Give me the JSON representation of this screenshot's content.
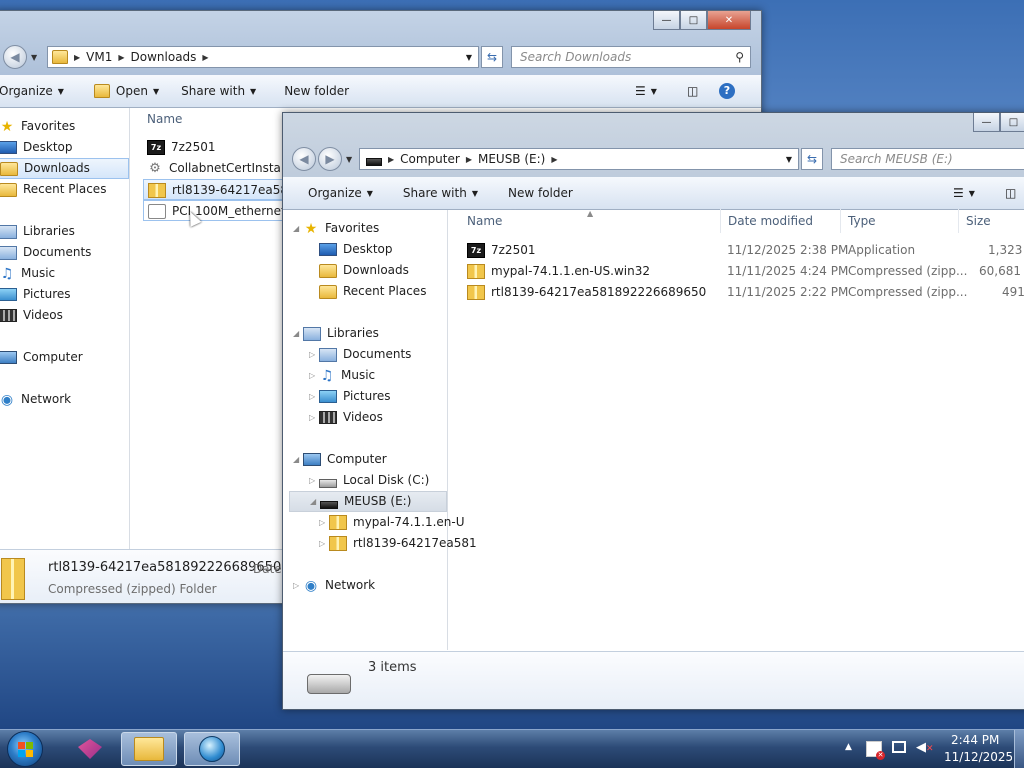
{
  "back_window": {
    "breadcrumb": [
      "VM1",
      "Downloads"
    ],
    "search_placeholder": "Search Downloads",
    "toolbar": {
      "organize": "Organize",
      "open": "Open",
      "share_with": "Share with",
      "new_folder": "New folder"
    },
    "nav": {
      "favorites": "Favorites",
      "desktop": "Desktop",
      "downloads": "Downloads",
      "recent_places": "Recent Places",
      "libraries": "Libraries",
      "documents": "Documents",
      "music": "Music",
      "pictures": "Pictures",
      "videos": "Videos",
      "computer": "Computer",
      "network": "Network"
    },
    "column_name": "Name",
    "files": [
      "7z2501",
      "CollabnetCertInstaller",
      "rtl8139-64217ea581892",
      "PCI 100M_ethernet_d"
    ],
    "details": {
      "name": "rtl8139-64217ea581892226689650",
      "type": "Compressed (zipped) Folder",
      "date_label": "Date"
    }
  },
  "front_window": {
    "breadcrumb": [
      "Computer",
      "MEUSB (E:)"
    ],
    "search_placeholder": "Search MEUSB (E:)",
    "toolbar": {
      "organize": "Organize",
      "share_with": "Share with",
      "new_folder": "New folder"
    },
    "nav": {
      "favorites": "Favorites",
      "desktop": "Desktop",
      "downloads": "Downloads",
      "recent_places": "Recent Places",
      "libraries": "Libraries",
      "documents": "Documents",
      "music": "Music",
      "pictures": "Pictures",
      "videos": "Videos",
      "computer": "Computer",
      "local_disk": "Local Disk (C:)",
      "meusb": "MEUSB (E:)",
      "sub1": "mypal-74.1.1.en-U",
      "sub2": "rtl8139-64217ea581",
      "network": "Network"
    },
    "columns": {
      "name": "Name",
      "date": "Date modified",
      "type": "Type",
      "size": "Size"
    },
    "files": [
      {
        "name": "7z2501",
        "date": "11/12/2025 2:38 PM",
        "type": "Application",
        "size": "1,323 K"
      },
      {
        "name": "mypal-74.1.1.en-US.win32",
        "date": "11/11/2025 4:24 PM",
        "type": "Compressed (zipp...",
        "size": "60,681 K"
      },
      {
        "name": "rtl8139-64217ea581892226689650",
        "date": "11/11/2025 2:22 PM",
        "type": "Compressed (zipp...",
        "size": "491 K"
      }
    ],
    "status": "3 items"
  },
  "taskbar": {
    "time": "2:44 PM",
    "date": "11/12/2025"
  }
}
